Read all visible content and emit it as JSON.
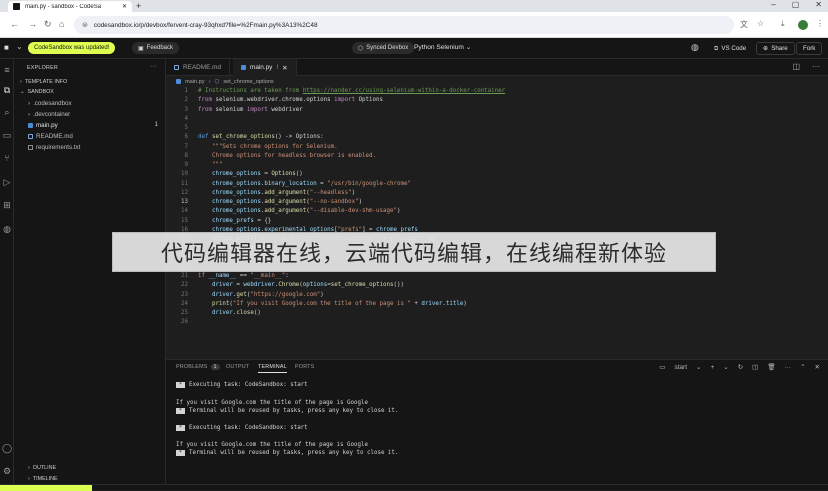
{
  "browser": {
    "tab_title": "main.py - sandbox - CodeSa",
    "url": "codesandbox.io/p/devbox/fervent-cray-93qhxd?file=%2Fmain.py%3A13%2C48"
  },
  "app_top": {
    "updated_label": "CodeSandbox was updated!",
    "feedback_label": "Feedback",
    "synced_label": "Synced Devbox",
    "template_name": "Python Selenium",
    "vscode_label": "VS Code",
    "share_label": "Share",
    "fork_label": "Fork"
  },
  "sidebar": {
    "title": "EXPLORER",
    "template_info": "TEMPLATE INFO",
    "sandbox": "SANDBOX",
    "items": [
      {
        "label": ".codesandbox"
      },
      {
        "label": ".devcontainer"
      },
      {
        "label": "main.py",
        "badge": "1"
      },
      {
        "label": "README.md"
      },
      {
        "label": "requirements.txt"
      }
    ],
    "outline": "OUTLINE",
    "timeline": "TIMELINE"
  },
  "editor": {
    "tabs": [
      {
        "label": "README.md"
      },
      {
        "label": "main.py",
        "modified": "!"
      }
    ],
    "breadcrumb_file": "main.py",
    "breadcrumb_symbol": "set_chrome_options"
  },
  "banner": {
    "text": "代码编辑器在线，云端代码编辑，在线编程新体验"
  },
  "panel": {
    "tabs": {
      "problems": "PROBLEMS",
      "problems_count": "1",
      "output": "OUTPUT",
      "terminal": "TERMINAL",
      "ports": "PORTS"
    },
    "terminal_name": "start",
    "lines": [
      "Executing task: CodeSandbox: start",
      "If you visit Google.com the title of the page is Google",
      "Terminal will be reused by tasks, press any key to close it.",
      "Executing task: CodeSandbox: start",
      "If you visit Google.com the title of the page is Google",
      "Terminal will be reused by tasks, press any key to close it."
    ]
  },
  "colors": {
    "accent": "#dcff50",
    "editor_bg": "#1e1e1e",
    "sidebar_bg": "#151515"
  }
}
